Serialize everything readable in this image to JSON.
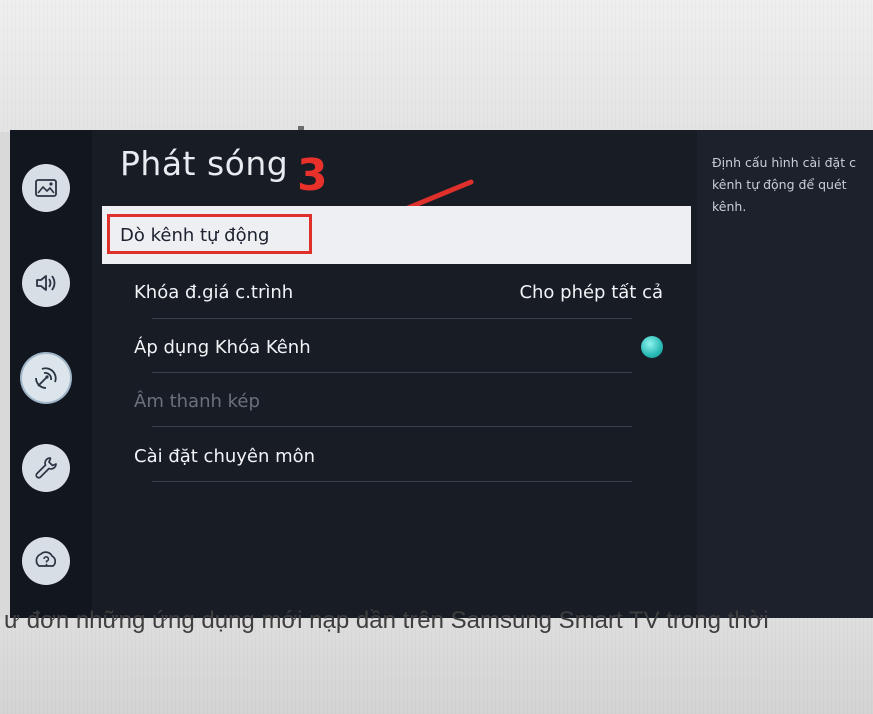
{
  "background": {
    "caption": "ư đơn những ứng dụng mới nạp dần trên Samsung Smart TV trong thời"
  },
  "sidebar": {
    "items": [
      {
        "icon": "picture-icon"
      },
      {
        "icon": "sound-icon"
      },
      {
        "icon": "broadcast-icon",
        "selected": true
      },
      {
        "icon": "wrench-icon"
      },
      {
        "icon": "support-icon"
      }
    ]
  },
  "main": {
    "title": "Phát sóng",
    "annotation_number": "3",
    "items": [
      {
        "label": "Dò kênh tự động",
        "value": ""
      },
      {
        "label": "Khóa đ.giá c.trình",
        "value": "Cho phép tất cả"
      },
      {
        "label": "Áp dụng Khóa Kênh",
        "toggle": true
      },
      {
        "label": "Âm thanh kép",
        "disabled": true
      },
      {
        "label": "Cài đặt chuyên môn"
      }
    ]
  },
  "info": {
    "text": "Định cấu hình cài đặt c\nkênh tự động để quét \nkênh."
  },
  "colors": {
    "accent_red": "#e0302b",
    "toggle_on": "#28b9b4",
    "panel_bg": "#171c25"
  }
}
